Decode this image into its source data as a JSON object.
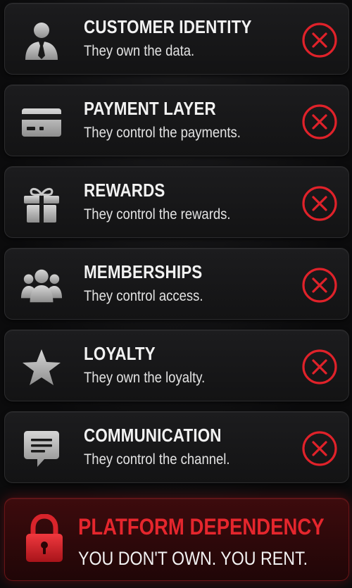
{
  "rows": [
    {
      "title": "CUSTOMER IDENTITY",
      "subtitle": "They own the data.",
      "icon": "person-icon"
    },
    {
      "title": "PAYMENT LAYER",
      "subtitle": "They control the payments.",
      "icon": "credit-card-icon"
    },
    {
      "title": "REWARDS",
      "subtitle": "They control the rewards.",
      "icon": "gift-icon"
    },
    {
      "title": "MEMBERSHIPS",
      "subtitle": "They control access.",
      "icon": "group-icon"
    },
    {
      "title": "LOYALTY",
      "subtitle": "They own the loyalty.",
      "icon": "star-icon"
    },
    {
      "title": "COMMUNICATION",
      "subtitle": "They control the channel.",
      "icon": "chat-icon"
    }
  ],
  "status_icon": "x-circle-icon",
  "alert": {
    "title": "PLATFORM DEPENDENCY",
    "subtitle": "YOU DON'T OWN. YOU RENT.",
    "icon": "lock-icon"
  },
  "colors": {
    "accent_red": "#e5262d",
    "icon_gray": "#b9b9b9",
    "background": "#0b0b0c"
  }
}
